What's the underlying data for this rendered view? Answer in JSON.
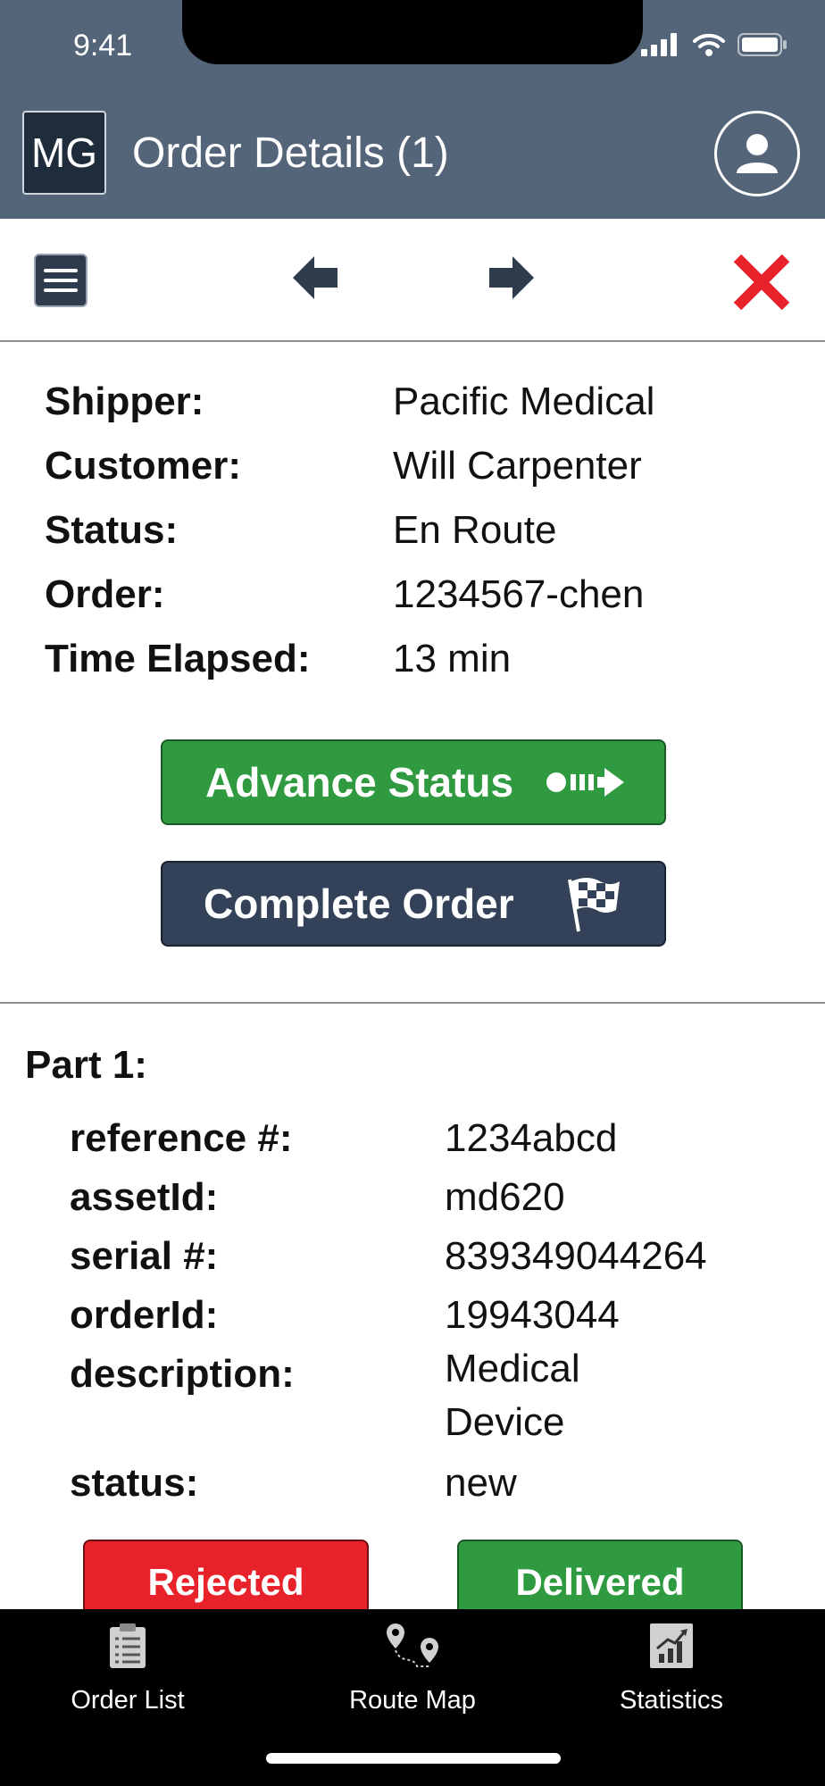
{
  "status_bar": {
    "time": "9:41"
  },
  "header": {
    "logo_text": "MG",
    "title": "Order Details (1)"
  },
  "order": {
    "rows": [
      {
        "label": "Shipper:",
        "value": "Pacific Medical"
      },
      {
        "label": "Customer:",
        "value": "Will Carpenter"
      },
      {
        "label": "Status:",
        "value": "En Route"
      },
      {
        "label": "Order:",
        "value": "1234567-chen"
      },
      {
        "label": "Time Elapsed:",
        "value": "13 min"
      }
    ],
    "advance_label": "Advance Status",
    "complete_label": "Complete Order"
  },
  "part": {
    "title": "Part 1:",
    "rows": [
      {
        "label": "reference #:",
        "value": "1234abcd"
      },
      {
        "label": "assetId:",
        "value": "md620"
      },
      {
        "label": "serial #:",
        "value": "839349044264"
      },
      {
        "label": "orderId:",
        "value": "19943044"
      },
      {
        "label": "description:",
        "value": "Medical",
        "value2": "Device"
      },
      {
        "label": "status:",
        "value": "new"
      }
    ],
    "rejected_label": "Rejected",
    "delivered_label": "Delivered"
  },
  "bottom_nav": [
    {
      "label": "Order List",
      "icon": "clipboard-list-icon"
    },
    {
      "label": "Route Map",
      "icon": "route-map-icon"
    },
    {
      "label": "Statistics",
      "icon": "statistics-chart-icon"
    }
  ],
  "colors": {
    "header": "#546579",
    "green": "#2f9a40",
    "navy": "#334258",
    "red": "#e8222a"
  }
}
